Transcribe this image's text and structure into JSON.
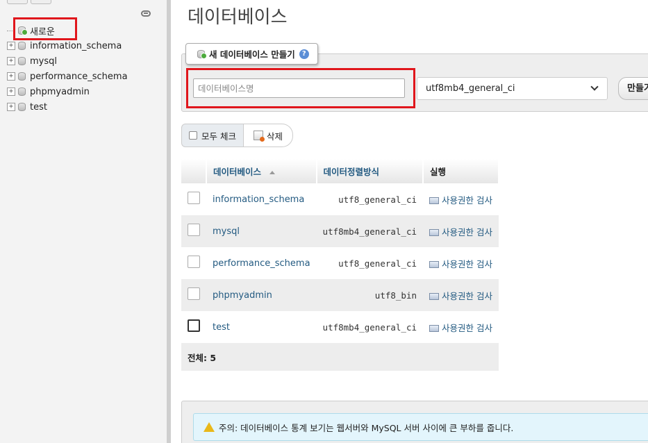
{
  "sidebar": {
    "new_label": "새로운",
    "databases": [
      {
        "name": "information_schema"
      },
      {
        "name": "mysql"
      },
      {
        "name": "performance_schema"
      },
      {
        "name": "phpmyadmin"
      },
      {
        "name": "test"
      }
    ]
  },
  "main": {
    "title": "데이터베이스",
    "create": {
      "legend": "새 데이터베이스 만들기",
      "help": "?",
      "name_placeholder": "데이터베이스명",
      "collation_value": "utf8mb4_general_ci",
      "create_label": "만들기"
    },
    "actions": {
      "check_all_label": "모두 체크",
      "delete_label": "삭제"
    },
    "table": {
      "headers": {
        "database": "데이터베이스",
        "collation": "데이터정렬방식",
        "action": "실행"
      },
      "rows": [
        {
          "name": "information_schema",
          "collation": "utf8_general_ci",
          "action": "사용권한 검사"
        },
        {
          "name": "mysql",
          "collation": "utf8mb4_general_ci",
          "action": "사용권한 검사"
        },
        {
          "name": "performance_schema",
          "collation": "utf8_general_ci",
          "action": "사용권한 검사"
        },
        {
          "name": "phpmyadmin",
          "collation": "utf8_bin",
          "action": "사용권한 검사"
        },
        {
          "name": "test",
          "collation": "utf8mb4_general_ci",
          "action": "사용권한 검사"
        }
      ],
      "total_label": "전체: 5"
    },
    "notice": "주의: 데이터베이스 통계 보기는 웹서버와 MySQL 서버 사이에 큰 부하를 줍니다."
  },
  "colors": {
    "highlight": "#e0161c",
    "link": "#235a81",
    "notice_bg": "#e3f5fc"
  }
}
